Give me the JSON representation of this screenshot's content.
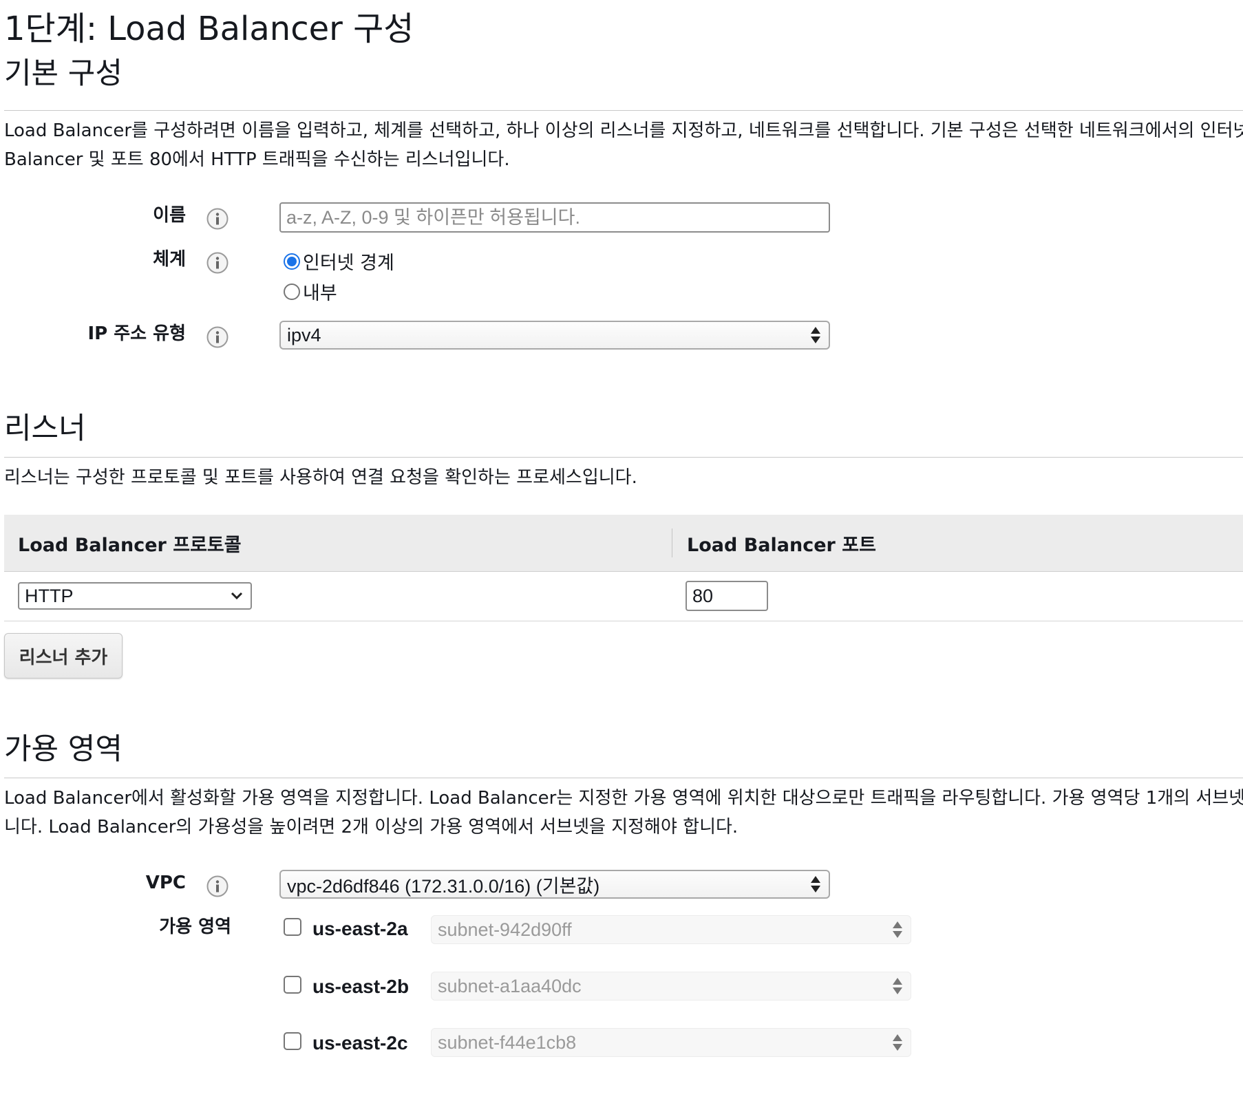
{
  "page_title": "1단계: Load Balancer 구성",
  "basic": {
    "title": "기본 구성",
    "desc_line1": "Load Balancer를 구성하려면 이름을 입력하고, 체계를 선택하고, 하나 이상의 리스너를 지정하고, 네트워크를 선택합니다. 기본 구성은 선택한 네트워크에서의 인터넷",
    "desc_line2": "Balancer 및 포트 80에서 HTTP 트래픽을 수신하는 리스너입니다.",
    "name_label": "이름",
    "name_placeholder": "a-z, A-Z, 0-9 및 하이픈만 허용됩니다.",
    "name_value": "",
    "scheme_label": "체계",
    "scheme_options": [
      "인터넷 경계",
      "내부"
    ],
    "scheme_selected": "인터넷 경계",
    "ip_label": "IP 주소 유형",
    "ip_value": "ipv4",
    "info_icon": "info-icon"
  },
  "listeners": {
    "title": "리스너",
    "desc": "리스너는 구성한 프로토콜 및 포트를 사용하여 연결 요청을 확인하는 프로세스입니다.",
    "col_protocol": "Load Balancer 프로토콜",
    "col_port": "Load Balancer 포트",
    "rows": [
      {
        "protocol": "HTTP",
        "port": "80"
      }
    ],
    "add_button": "리스너 추가"
  },
  "az": {
    "title": "가용 영역",
    "desc_line1": "Load Balancer에서 활성화할 가용 영역을 지정합니다. Load Balancer는 지정한 가용 영역에 위치한 대상으로만 트래픽을 라우팅합니다. 가용 영역당 1개의 서브넷",
    "desc_line2": "니다. Load Balancer의 가용성을 높이려면 2개 이상의 가용 영역에서 서브넷을 지정해야 합니다.",
    "vpc_label": "VPC",
    "vpc_value": "vpc-2d6df846 (172.31.0.0/16) (기본값)",
    "zones_label": "가용 영역",
    "zones": [
      {
        "name": "us-east-2a",
        "subnet": "subnet-942d90ff",
        "checked": false
      },
      {
        "name": "us-east-2b",
        "subnet": "subnet-a1aa40dc",
        "checked": false
      },
      {
        "name": "us-east-2c",
        "subnet": "subnet-f44e1cb8",
        "checked": false
      }
    ]
  },
  "colors": {
    "accent": "#1a73e8",
    "header_bg": "#ececec",
    "text": "#16191f",
    "disabled_text": "#9a9a9a"
  }
}
